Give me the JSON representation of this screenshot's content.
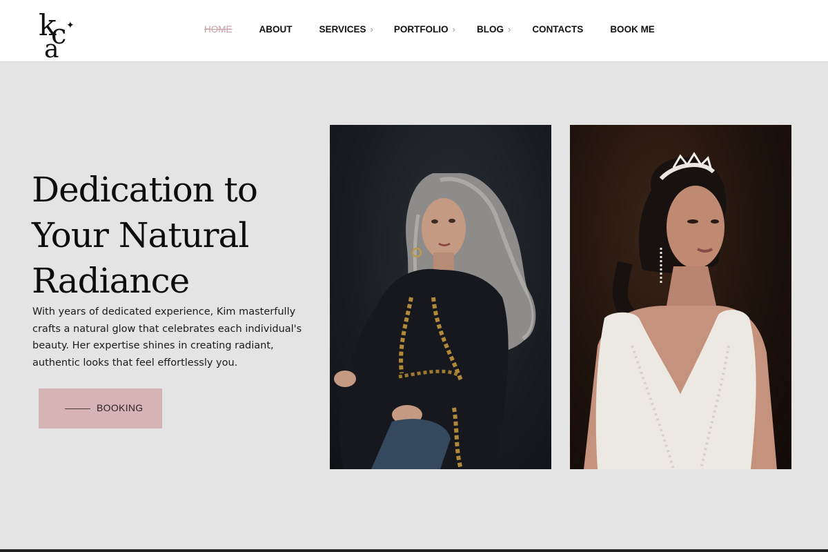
{
  "brand": {
    "logo_letters": [
      "k",
      "c",
      "a",
      "✦"
    ]
  },
  "nav": {
    "items": [
      {
        "label": "HOME",
        "active": true,
        "has_submenu": false
      },
      {
        "label": "ABOUT",
        "active": false,
        "has_submenu": false
      },
      {
        "label": "SERVICES",
        "active": false,
        "has_submenu": true
      },
      {
        "label": "PORTFOLIO",
        "active": false,
        "has_submenu": true
      },
      {
        "label": "BLOG",
        "active": false,
        "has_submenu": true
      },
      {
        "label": "CONTACTS",
        "active": false,
        "has_submenu": false
      },
      {
        "label": "BOOK ME",
        "active": false,
        "has_submenu": false
      }
    ],
    "submenu_icon": "chevron-right-icon",
    "chevron_glyph": "›"
  },
  "hero": {
    "title_lines": [
      "Dedication to",
      "Your Natural",
      "Radiance"
    ],
    "text": "With years of dedicated experience, Kim masterfully crafts a natural glow that celebrates each individual's beauty. Her expertise shines in creating radiant, authentic looks that feel effortlessly you.",
    "button_label": "BOOKING"
  },
  "colors": {
    "accent": "#d6b3b4",
    "active_nav": "#c9a0a3",
    "background": "#e4e4e4"
  }
}
